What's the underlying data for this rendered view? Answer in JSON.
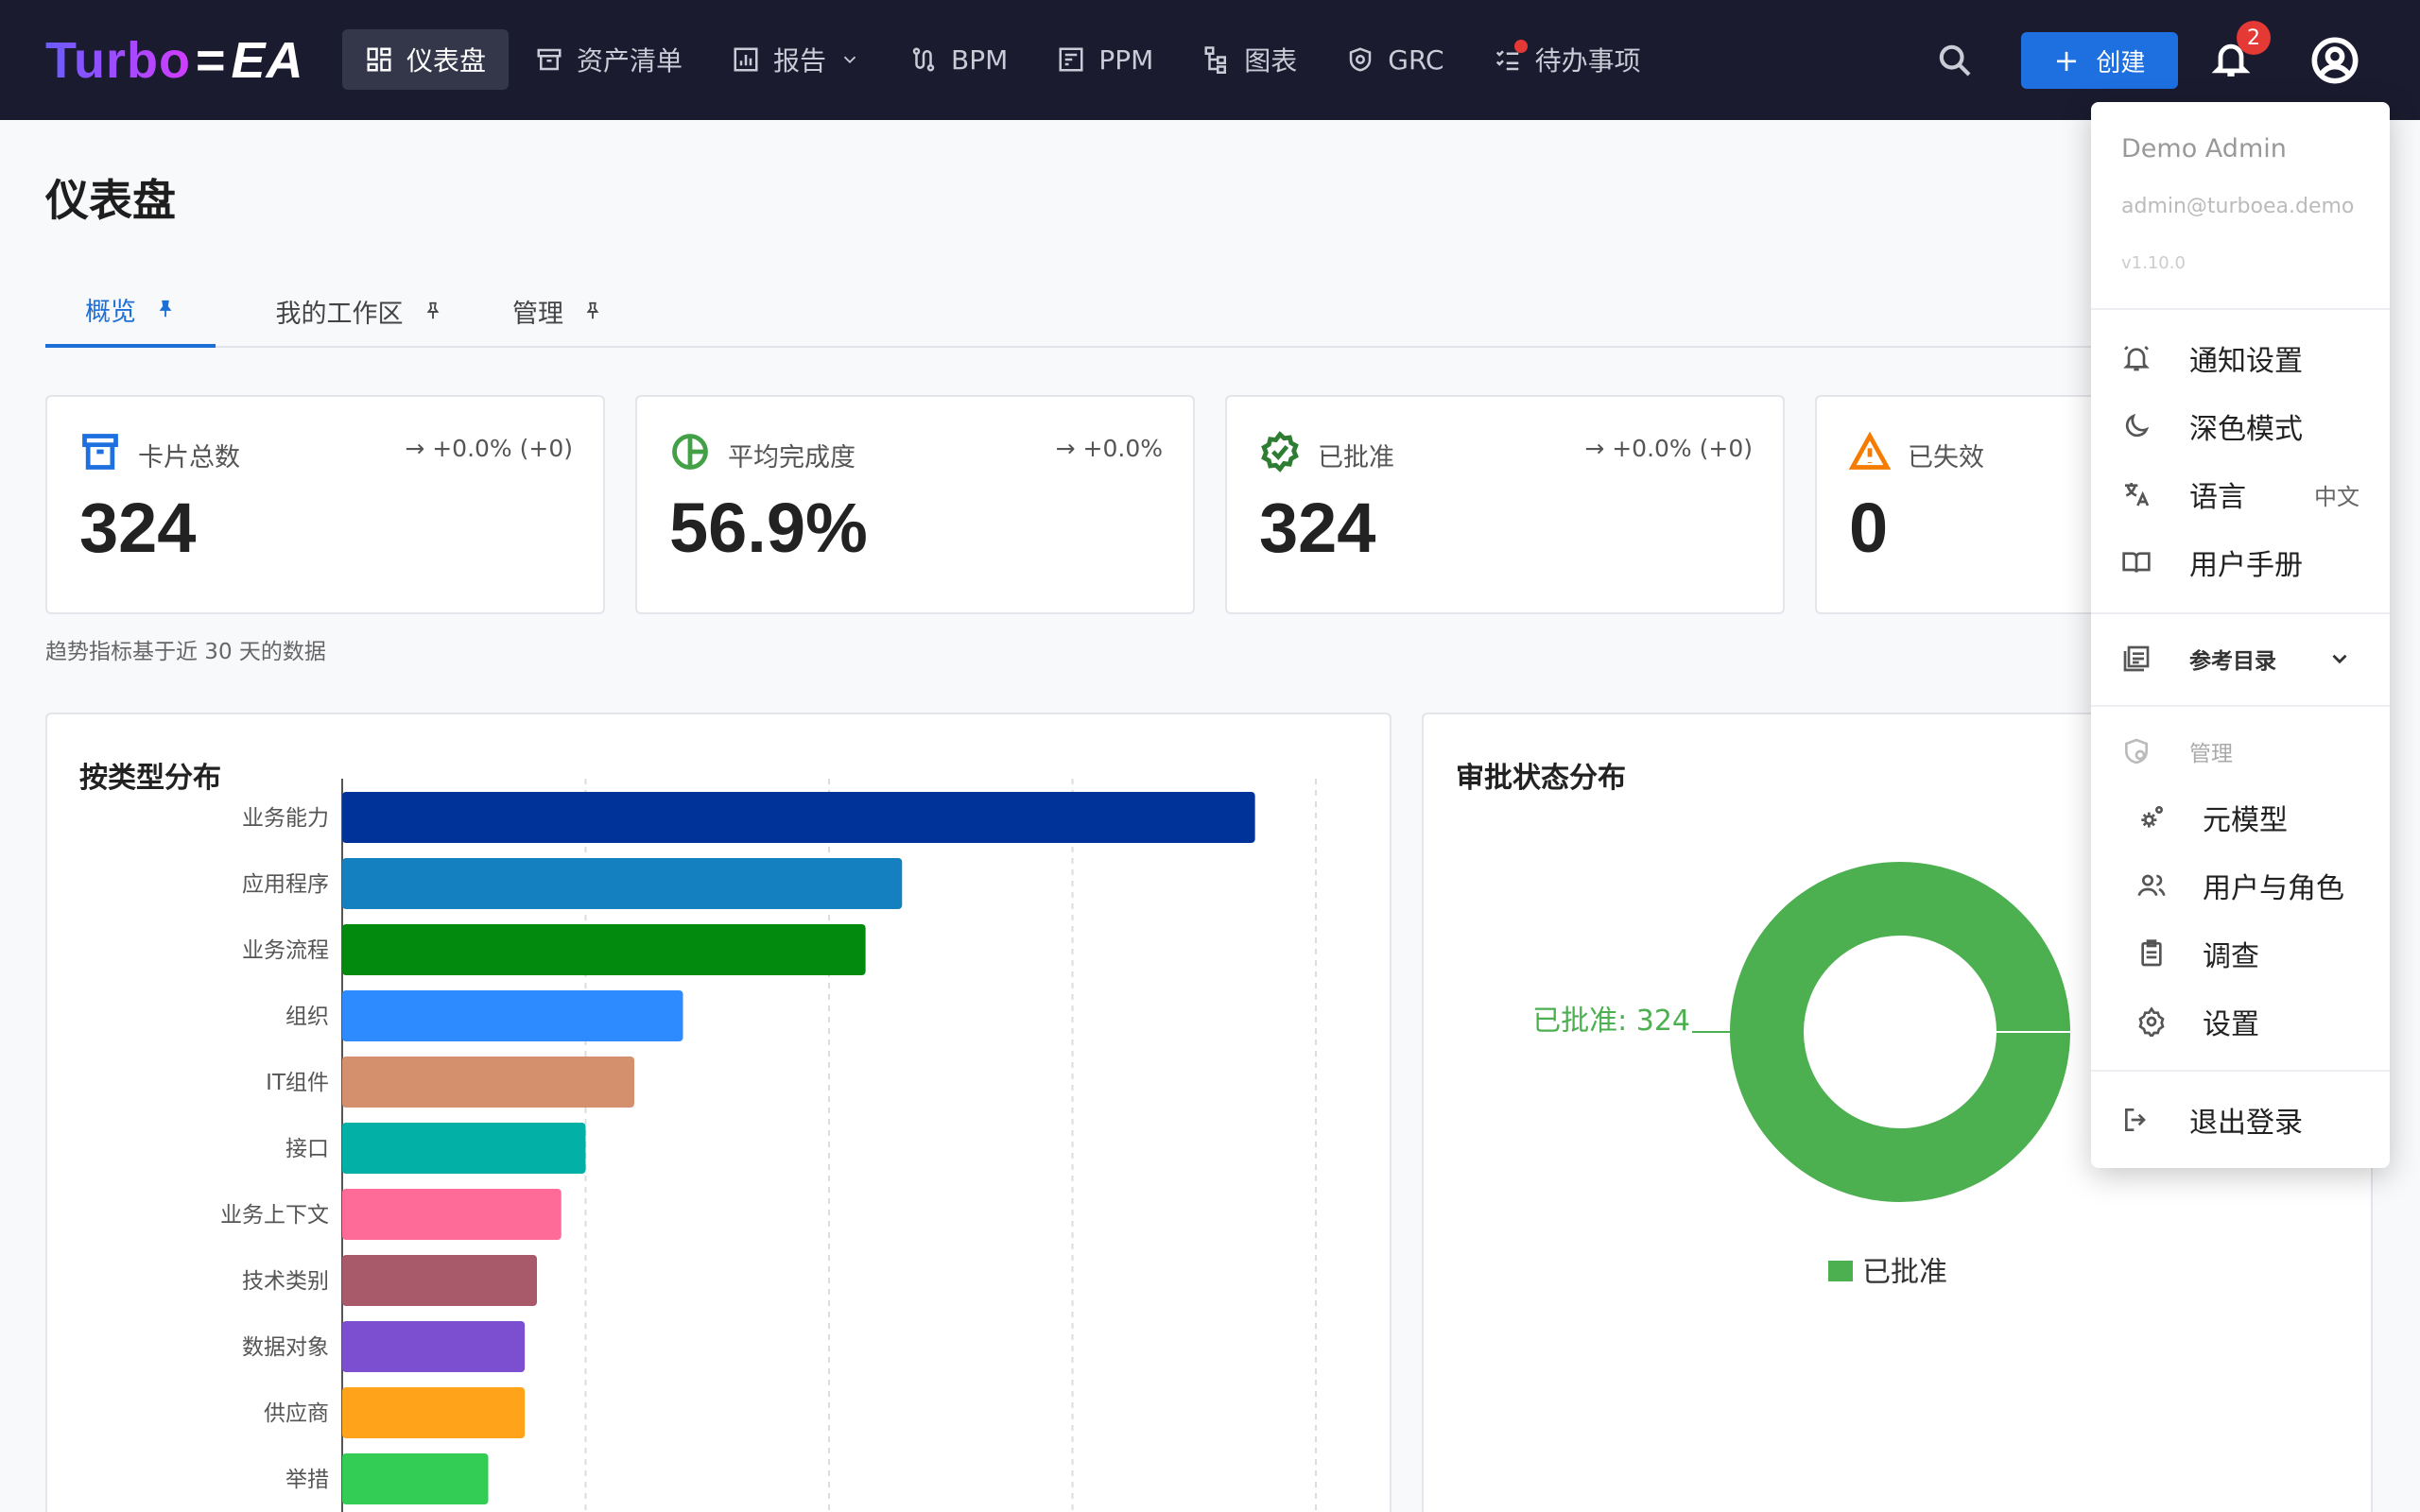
{
  "brand": {
    "turbo": "Turbo",
    "ea": "EA",
    "dash": "="
  },
  "nav": {
    "items": [
      {
        "label": "仪表盘",
        "icon": "dashboard-icon",
        "active": true
      },
      {
        "label": "资产清单",
        "icon": "archive-icon"
      },
      {
        "label": "报告",
        "icon": "bar-chart-icon",
        "dropdown": true
      },
      {
        "label": "BPM",
        "icon": "route-icon"
      },
      {
        "label": "PPM",
        "icon": "project-icon"
      },
      {
        "label": "图表",
        "icon": "diagram-icon"
      },
      {
        "label": "GRC",
        "icon": "shield-icon"
      },
      {
        "label": "待办事项",
        "icon": "checklist-icon",
        "dot": true
      }
    ],
    "create_label": "创建",
    "notification_count": "2"
  },
  "page": {
    "title": "仪表盘",
    "tabs": [
      {
        "label": "概览",
        "active": true
      },
      {
        "label": "我的工作区"
      },
      {
        "label": "管理"
      }
    ],
    "trend_note": "趋势指标基于近 30 天的数据"
  },
  "kpis": [
    {
      "label": "卡片总数",
      "value": "324",
      "trend": "→ +0.0% (+0)",
      "icon": "archive-icon",
      "color": "#1e6fe0"
    },
    {
      "label": "平均完成度",
      "value": "56.9%",
      "trend": "→ +0.0%",
      "icon": "pie-icon",
      "color": "#43a047"
    },
    {
      "label": "已批准",
      "value": "324",
      "trend": "→ +0.0% (+0)",
      "icon": "verified-icon",
      "color": "#2e7d32"
    },
    {
      "label": "已失效",
      "value": "0",
      "trend": "",
      "icon": "warning-icon",
      "color": "#f57c00"
    }
  ],
  "charts": {
    "type_title": "按类型分布",
    "status_title": "审批状态分布"
  },
  "chart_data": [
    {
      "type": "bar",
      "orientation": "horizontal",
      "categories": [
        "业务能力",
        "应用程序",
        "业务流程",
        "组织",
        "IT组件",
        "接口",
        "业务上下文",
        "技术类别",
        "数据对象",
        "供应商",
        "举措"
      ],
      "values": [
        75,
        46,
        43,
        28,
        24,
        20,
        18,
        16,
        15,
        15,
        12
      ],
      "colors": [
        "#003399",
        "#1480c0",
        "#028a0f",
        "#2e8bff",
        "#d4906c",
        "#02b0a5",
        "#ff6b98",
        "#a8596a",
        "#7b4fd0",
        "#ffa31a",
        "#33cc55"
      ],
      "xlim": [
        0,
        80
      ],
      "grid": true
    },
    {
      "type": "pie",
      "donut": true,
      "categories": [
        "已批准"
      ],
      "values": [
        324
      ],
      "colors": [
        "#4caf50"
      ],
      "data_labels": [
        "已批准: 324"
      ],
      "legend": [
        "已批准"
      ],
      "legend_position": "bottom"
    }
  ],
  "menu": {
    "user_name": "Demo Admin",
    "email": "admin@turboea.demo",
    "version": "v1.10.0",
    "items": [
      {
        "label": "通知设置",
        "icon": "bell-settings-icon"
      },
      {
        "label": "深色模式",
        "icon": "moon-icon"
      },
      {
        "label": "语言",
        "icon": "translate-icon",
        "value": "中文"
      },
      {
        "label": "用户手册",
        "icon": "book-icon"
      }
    ],
    "catalog_label": "参考目录",
    "admin_label": "管理",
    "admin_items": [
      {
        "label": "元模型",
        "icon": "gears-icon"
      },
      {
        "label": "用户与角色",
        "icon": "users-icon"
      },
      {
        "label": "调查",
        "icon": "clipboard-icon"
      },
      {
        "label": "设置",
        "icon": "gear-icon"
      }
    ],
    "logout_label": "退出登录"
  }
}
